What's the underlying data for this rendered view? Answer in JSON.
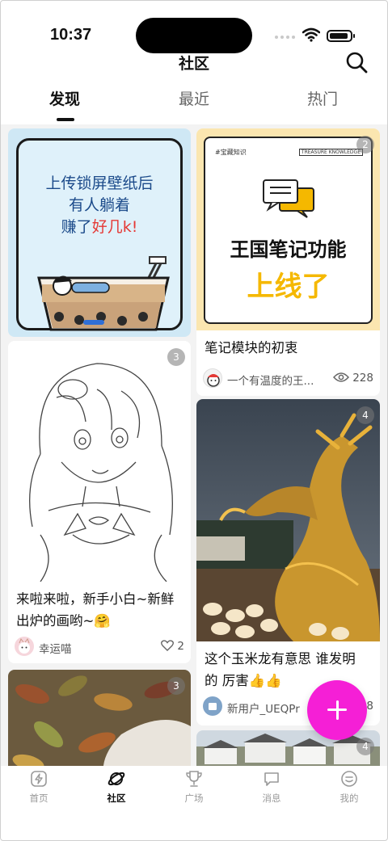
{
  "status_bar": {
    "time": "10:37"
  },
  "header": {
    "title": "社区",
    "search_icon": "search-icon"
  },
  "tabs": [
    {
      "label": "发现",
      "active": true
    },
    {
      "label": "最近",
      "active": false
    },
    {
      "label": "热门",
      "active": false
    }
  ],
  "posts": [
    {
      "image": {
        "line1": "上传锁屏壁纸后",
        "line2": "有人躺着",
        "line3a": "赚了",
        "line3b": "好几k!"
      },
      "image_icon": "bubble-tea-illustration"
    },
    {
      "badge": "2",
      "image": {
        "tag": "#宝藏知识",
        "tag_right": "TREASURE KNOWLEDGE",
        "headline": "王国笔记功能",
        "highlight": "上线了"
      },
      "image_icon": "note-chat-icon",
      "caption": "笔记模块的初衷",
      "author": "一个有温度的王...",
      "views": "228",
      "count_icon": "eye-icon"
    },
    {
      "badge": "3",
      "image_icon": "anime-girl-sketch",
      "caption_line1": "来啦来啦，新手小白~新鲜",
      "caption_line2": "出炉的画哟~🤗",
      "author": "幸运喵",
      "likes": "2",
      "count_icon": "heart-icon"
    },
    {
      "badge": "4",
      "image_icon": "golden-dragon-photo",
      "caption_line1": "这个玉米龙有意思 谁发明",
      "caption_line2": "的 厉害👍👍",
      "author": "新用户_UEQPr",
      "views": "8"
    },
    {
      "badge": "3",
      "image_icon": "autumn-leaves-photo"
    },
    {
      "badge": "4",
      "image_icon": "village-photo"
    }
  ],
  "fab": {
    "icon": "plus-icon"
  },
  "bottom_nav": [
    {
      "label": "首页",
      "icon": "home-bolt-icon",
      "active": false
    },
    {
      "label": "社区",
      "icon": "planet-icon",
      "active": true
    },
    {
      "label": "广场",
      "icon": "trophy-icon",
      "active": false
    },
    {
      "label": "消息",
      "icon": "message-icon",
      "active": false
    },
    {
      "label": "我的",
      "icon": "profile-icon",
      "active": false
    }
  ],
  "colors": {
    "accent": "#f51fd6",
    "highlight_yellow": "#f5b800",
    "red": "#e53935"
  }
}
